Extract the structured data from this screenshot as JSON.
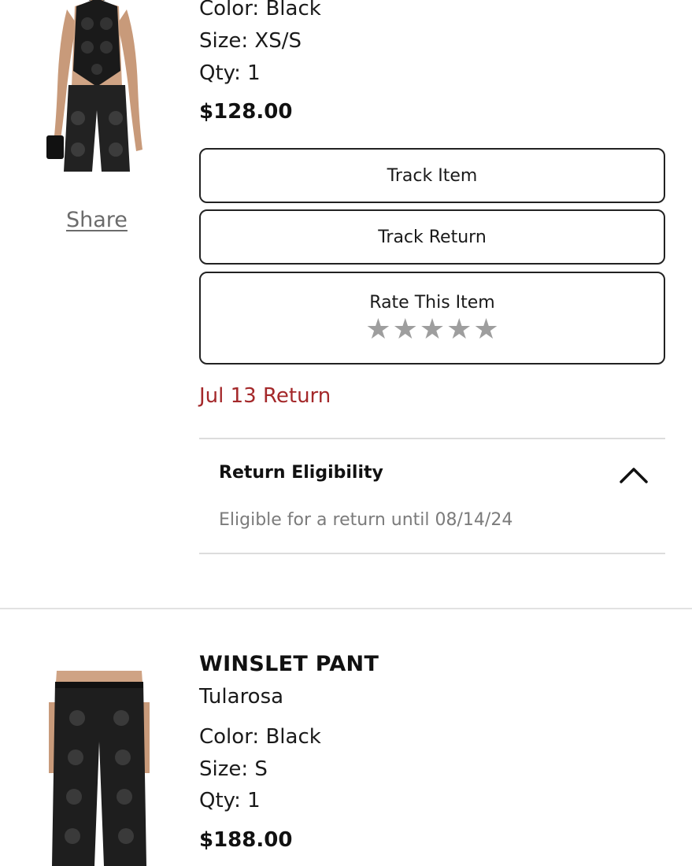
{
  "item1": {
    "image_alt": "Black crochet halter top",
    "share_label": "Share",
    "color": "Color: Black",
    "size": "Size: XS/S",
    "qty": "Qty: 1",
    "price": "$128.00",
    "buttons": {
      "track_item": "Track Item",
      "track_return": "Track Return",
      "rate_item": "Rate This Item"
    },
    "rating": {
      "max_stars": 5,
      "filled": 0
    },
    "return_status": "Jul 13 Return",
    "return_eligibility": {
      "title": "Return Eligibility",
      "text": "Eligible for a return until 08/14/24",
      "expanded": true
    }
  },
  "item2": {
    "image_alt": "Black crochet pants",
    "name": "WINSLET PANT",
    "brand": "Tularosa",
    "color": "Color: Black",
    "size": "Size: S",
    "qty": "Qty: 1",
    "price": "$188.00"
  },
  "colors": {
    "return_status": "#a4282a",
    "star": "#9e9e9e",
    "muted_text": "#7b7b7b",
    "border": "#222222"
  }
}
